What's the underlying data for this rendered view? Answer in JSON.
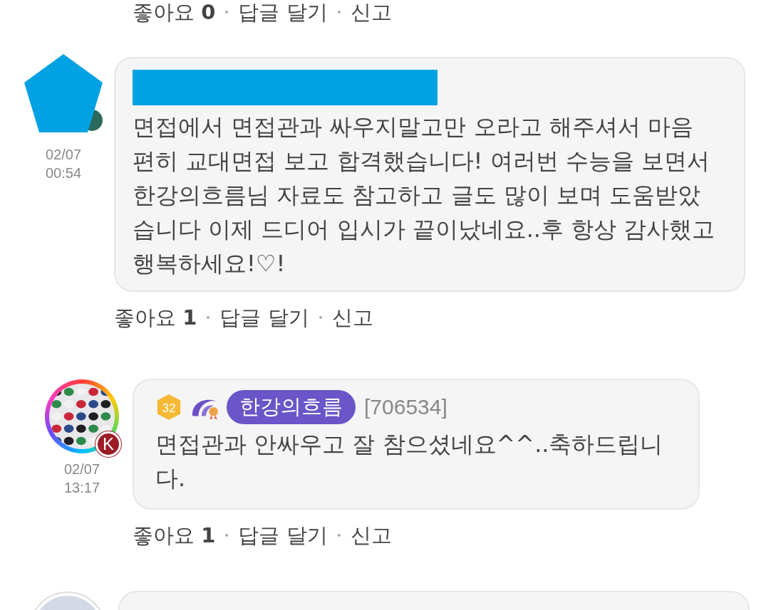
{
  "top_actions": {
    "like_label": "좋아요",
    "like_count": "0",
    "reply": "답글 달기",
    "report": "신고"
  },
  "comments": [
    {
      "kind": "comment",
      "avatar": {
        "kind": "redacted"
      },
      "date": "02/07",
      "time": "00:54",
      "redacted_name": true,
      "text": "면접에서 면접관과 싸우지말고만 오라고 해주셔서 마음 편히 교대면접 보고 합격했습니다! 여러번 수능을 보면서 한강의흐름님 자료도 참고하고 글도 많이 보며 도움받았 습니다 이제 드디어 입시가 끝이났네요..후 항상 감사했고 행복하세요!♡!",
      "actions": {
        "like_label": "좋아요",
        "like_count": "1",
        "reply": "답글 달기",
        "report": "신고"
      }
    },
    {
      "kind": "reply",
      "avatar": {
        "kind": "picture",
        "badge": "K"
      },
      "date": "02/07",
      "time": "13:17",
      "level": "32",
      "name": "한강의흐름",
      "user_id": "[706534]",
      "text": "면접관과 안싸우고 잘 참으셨네요^^..축하드립니다.",
      "actions": {
        "like_label": "좋아요",
        "like_count": "1",
        "reply": "답글 달기",
        "report": "신고"
      }
    },
    {
      "kind": "comment",
      "avatar": {
        "kind": "plain"
      }
    }
  ]
}
